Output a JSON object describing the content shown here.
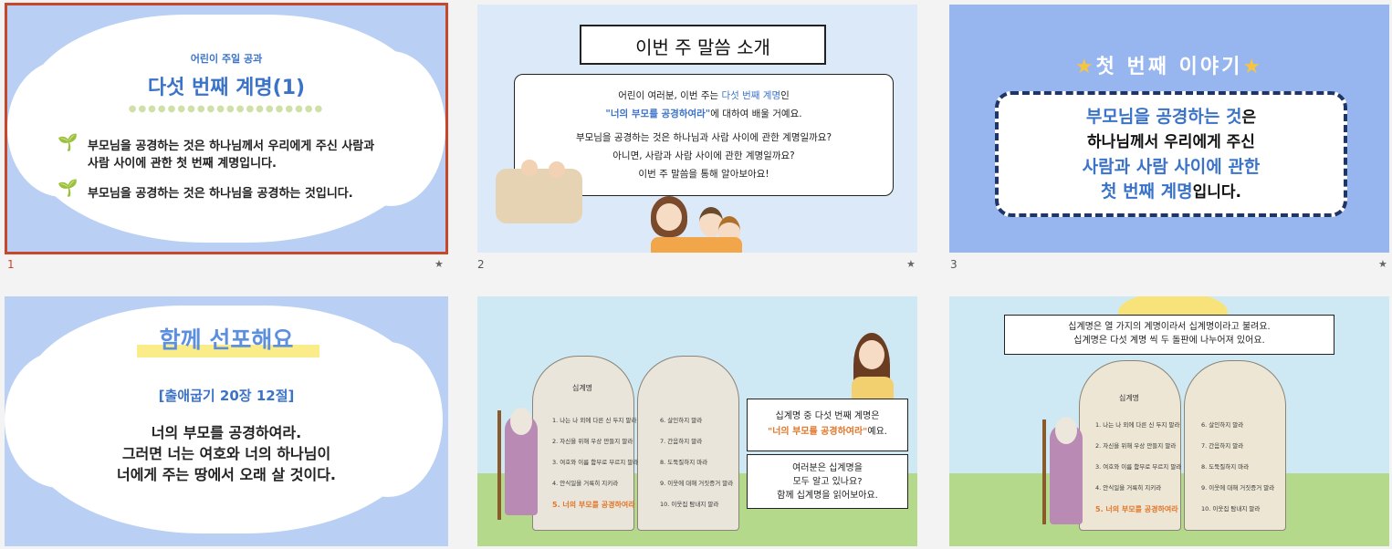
{
  "slides": [
    {
      "number": "1",
      "subtitle": "어린이 주일 공과",
      "title": "다섯 번째 계명(1)",
      "bullets": [
        "부모님을 공경하는 것은 하나님께서 우리에게 주신 사람과",
        "사람 사이에 관한 첫 번째 계명입니다.",
        "부모님을 공경하는 것은 하나님을 공경하는 것입니다."
      ]
    },
    {
      "number": "2",
      "title": "이번 주 말씀 소개",
      "line1_a": "어린이 여러분, 이번 주는 ",
      "line1_b": "다섯 번째 계명",
      "line1_c": "인",
      "line2_a": "\"너의 부모를 공경하여라\"",
      "line2_b": "에 대하여 배울 거예요.",
      "line3": "부모님을 공경하는 것은 하나님과 사람 사이에 관한 계명일까요?",
      "line4": "아니면, 사람과 사람 사이에 관한 계명일까요?",
      "line5": "이번 주 말씀을 통해 알아보아요!"
    },
    {
      "number": "3",
      "title": "첫 번째 이야기",
      "l1a": "부모님을 공경하는 것",
      "l1b": "은",
      "l2": "하나님께서 우리에게 주신",
      "l3": "사람과 사람 사이에 관한",
      "l4a": "첫 번째 계명",
      "l4b": "입니다."
    },
    {
      "title": "함께 선포해요",
      "ref": "[출애굽기 20장 12절]",
      "verse": [
        "너의 부모를 공경하여라.",
        "그러면 너는 여호와 너의 하나님이",
        "너에게 주는 땅에서 오래 살 것이다."
      ]
    },
    {
      "tablet_title": "십계명",
      "left": [
        "1. 나는 나 외에 다른 신 두지 말라",
        "2. 자신을 위해 우상 만들지 말라",
        "3. 여호와 이름 함부로 부르지 말라",
        "4. 안식일을 거룩히 지키라",
        "5. 너의 부모를 공경하여라"
      ],
      "right": [
        "6. 살인하지 말라",
        "7. 간음하지 말라",
        "8. 도둑질하지 마라",
        "9. 이웃에 대해 거짓증거 말라",
        "10. 이웃집 탐내지 말라"
      ],
      "box1_a": "십계명 중 다섯 번째 계명은",
      "box1_b": "\"너의 부모를 공경하여라\"",
      "box1_c": "예요.",
      "box2": [
        "여러분은 십계명을",
        "모두 알고 있나요?",
        "함께 십계명을 읽어보아요."
      ]
    },
    {
      "top": [
        "십계명은 열 가지의 계명이라서 십계명이라고 불려요.",
        "십계명은 다섯 계명 씩 두 돌판에 나누어져 있어요."
      ]
    }
  ],
  "star_icon": "★"
}
